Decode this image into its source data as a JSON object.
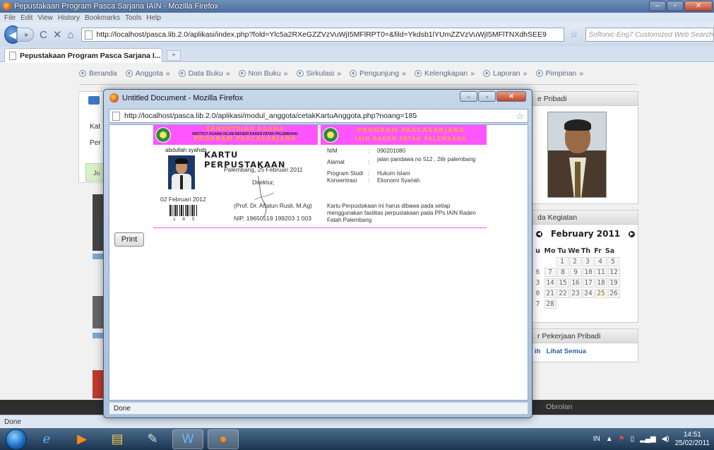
{
  "browser": {
    "title": "Pepustakaan Program Pasca Sarjana IAIN - Mozilla Firefox",
    "menu": [
      "File",
      "Edit",
      "View",
      "History",
      "Bookmarks",
      "Tools",
      "Help"
    ],
    "url": "http://localhost/pasca.lib.2.0/aplikasi/index.php?fold=Ylc5a2RXeGZZVzVuWjI5MFlRPT0=&fild=Ykdsb1lYUmZZVzVuWjI5MFlTNXdhSEE9",
    "search_placeholder": "Softonic-Eng7 Customized Web Search",
    "tab_label": "Pepustakaan Program Pasca Sarjana I...",
    "tab_new": "+",
    "status": "Done"
  },
  "site": {
    "nav": [
      "Beranda",
      "Anggota",
      "Data Buku",
      "Non Buku",
      "Sirkulasi",
      "Pengunjung",
      "Kelengkapan",
      "Laporan",
      "Pimpinan"
    ],
    "left_labels": [
      "Kat",
      "Per",
      "Ju"
    ],
    "right": {
      "profile_header": "e Pribadi",
      "calendar_header": "da Kegiatan",
      "calendar_month": "February 2011",
      "calendar_days": [
        "u",
        "Mo",
        "Tu",
        "We",
        "Th",
        "Fr",
        "Sa"
      ],
      "calendar_rows": [
        [
          "",
          "",
          "1",
          "2",
          "3",
          "4",
          "5"
        ],
        [
          "6",
          "7",
          "8",
          "9",
          "10",
          "11",
          "12"
        ],
        [
          "3",
          "14",
          "15",
          "16",
          "17",
          "18",
          "19"
        ],
        [
          "0",
          "21",
          "22",
          "23",
          "24",
          "25",
          "26"
        ],
        [
          "7",
          "28",
          "",
          "",
          "",
          "",
          ""
        ]
      ],
      "work_header": "r Pekerjaan Pribadi",
      "work_link_1": "ih",
      "work_link_2": "Lihat Semua"
    },
    "footer_text": "Obrolan"
  },
  "popup": {
    "title": "Untitled Document - Mozilla Firefox",
    "url": "http://localhost/pasca.lib.2.0/aplikasi/modul_anggota/cetakKartuAnggota.php?noang=185",
    "status": "Done",
    "print_label": "Print",
    "card": {
      "left_banner_1": "KEMENTRIAN AGAMA",
      "left_banner_2": "INSTITUT AGAMA ISLAM NEGERI RADEN FATAH PALEMBANG",
      "left_banner_3": "PROGRAM PASCASARJANA",
      "right_banner_1": "PROGRAM PASCASARJANA",
      "right_banner_2": "IAIN RADEN FATAH PALEMBANG",
      "member_name": "abdullah syahab",
      "title": "KARTU PERPUSTAKAAN",
      "place_date": "Palembang, 25 Februari 2011",
      "direktur": "Direktur,",
      "issue_date": "02 Februari 2012",
      "barcode_number": "1 8 5",
      "signatory": "(Prof. Dr. Aflatun Rusli, M.Ag)",
      "nip": "NIP. 19650519 199203 1 003",
      "fields": [
        {
          "label": "NIM",
          "value": "090201080"
        },
        {
          "label": "Alamat",
          "value": "jalan pandawa no 512 , 2ilir palembang"
        },
        {
          "label": "Program Studi",
          "value": "Hukum Islam"
        },
        {
          "label": "Konsentrasi",
          "value": "Ekonomi Syariah"
        }
      ],
      "note": "Kartu Perpustakaan ini harus dibawa pada setiap menggunakan fasilitas perpustakaan pada PPs IAIN Raden Fatah Palembang"
    }
  },
  "taskbar": {
    "lang": "IN",
    "time": "14:51",
    "date": "25/02/2011"
  }
}
